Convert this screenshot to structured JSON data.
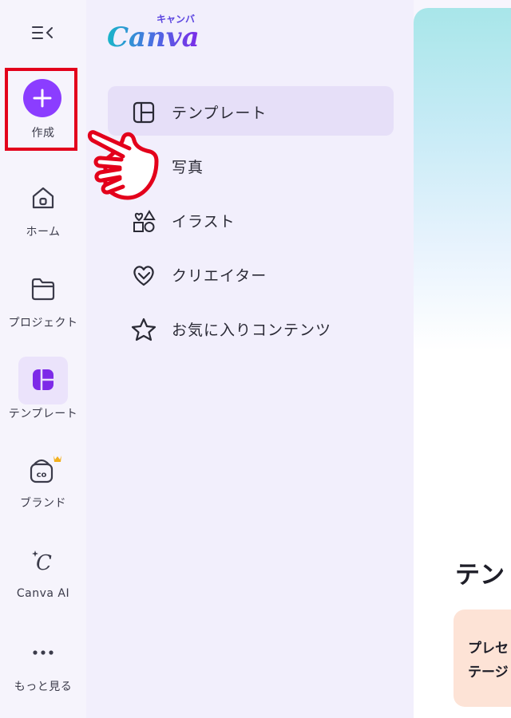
{
  "rail": {
    "collapse_icon": "collapse-menu-icon",
    "items": [
      {
        "label": "作成",
        "icon": "plus-icon"
      },
      {
        "label": "ホーム",
        "icon": "home-icon"
      },
      {
        "label": "プロジェクト",
        "icon": "folder-icon"
      },
      {
        "label": "テンプレート",
        "icon": "template-icon"
      },
      {
        "label": "ブランド",
        "icon": "brand-icon"
      },
      {
        "label": "Canva AI",
        "icon": "canva-ai-icon"
      },
      {
        "label": "もっと見る",
        "icon": "more-icon"
      }
    ]
  },
  "logo": {
    "text": "Canva",
    "kana": "キャンバ"
  },
  "panel": {
    "items": [
      {
        "label": "テンプレート",
        "icon": "layout-icon",
        "active": true
      },
      {
        "label": "写真",
        "icon": "photo-icon"
      },
      {
        "label": "イラスト",
        "icon": "shapes-icon"
      },
      {
        "label": "クリエイター",
        "icon": "heart-creator-icon"
      },
      {
        "label": "お気に入りコンテンツ",
        "icon": "star-icon"
      }
    ]
  },
  "main": {
    "heading": "テン",
    "card_line1": "プレセ",
    "card_line2": "テージ"
  },
  "colors": {
    "accent": "#8b3dff",
    "highlight": "#e3001b",
    "crown": "#f2b01e"
  }
}
